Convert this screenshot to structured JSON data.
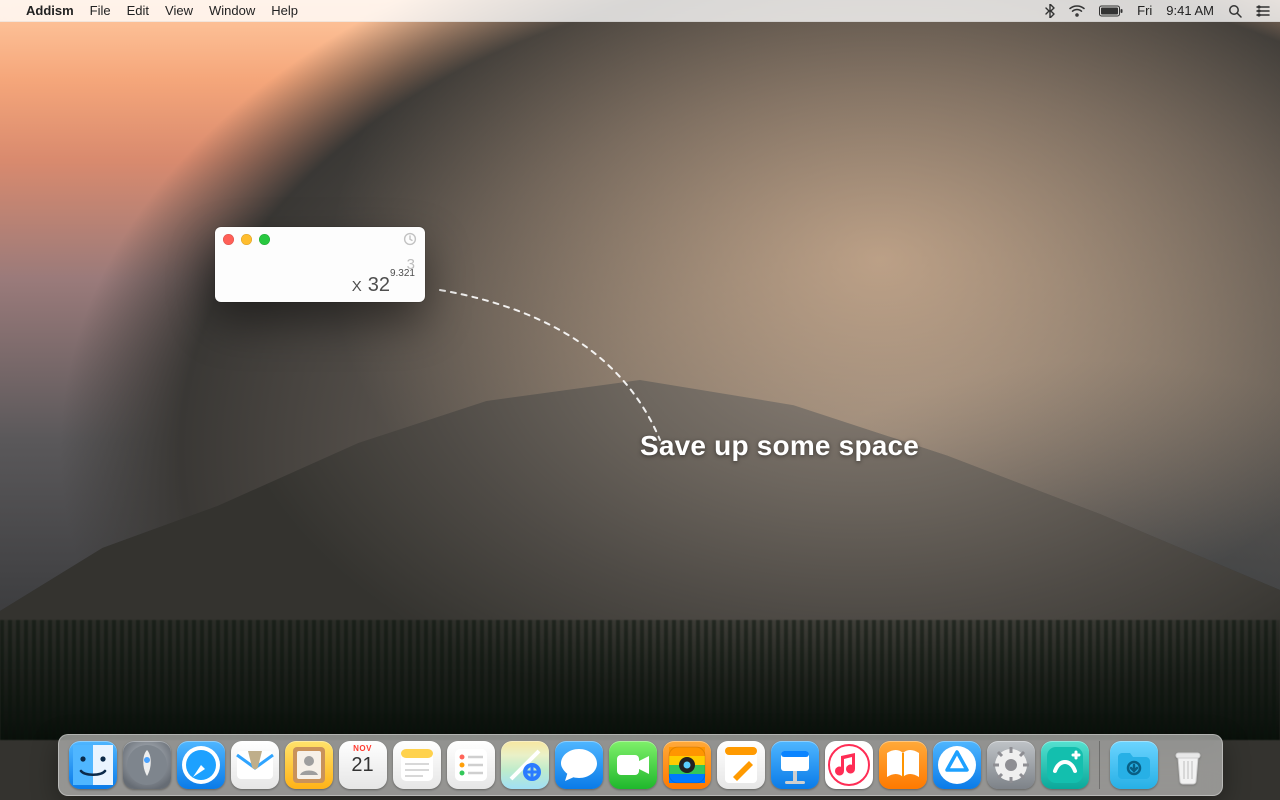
{
  "menubar": {
    "app_name": "Addism",
    "items": [
      "File",
      "Edit",
      "View",
      "Window",
      "Help"
    ],
    "status": {
      "day": "Fri",
      "time": "9:41 AM"
    }
  },
  "promo": {
    "caption": "Save up some space"
  },
  "mini_window": {
    "prev_value": "3",
    "operator": "X",
    "base": "32",
    "exponent": "9.321"
  },
  "dock": {
    "calendar": {
      "month": "NOV",
      "day": "21"
    },
    "items": [
      {
        "name": "finder",
        "label": "Finder",
        "class": "grad-blue",
        "glyph_svg": "finder"
      },
      {
        "name": "launchpad",
        "label": "Launchpad",
        "class": "grad-launch",
        "glyph_svg": "rocket"
      },
      {
        "name": "safari",
        "label": "Safari",
        "class": "grad-blue",
        "glyph_svg": "compass"
      },
      {
        "name": "mail",
        "label": "Mail",
        "class": "grad-white",
        "glyph_svg": "mail"
      },
      {
        "name": "contacts",
        "label": "Contacts",
        "class": "grad-yellow",
        "glyph_svg": "contacts"
      },
      {
        "name": "calendar",
        "label": "Calendar",
        "class": "grad-white",
        "glyph_svg": "calendar"
      },
      {
        "name": "notes",
        "label": "Notes",
        "class": "grad-white",
        "glyph_svg": "notes"
      },
      {
        "name": "reminders",
        "label": "Reminders",
        "class": "grad-white",
        "glyph_svg": "reminders"
      },
      {
        "name": "maps",
        "label": "Maps",
        "class": "grad-maps",
        "glyph_svg": "maps"
      },
      {
        "name": "messages",
        "label": "Messages",
        "class": "grad-blue",
        "glyph_svg": "bubble"
      },
      {
        "name": "facetime",
        "label": "FaceTime",
        "class": "grad-green",
        "glyph_svg": "video"
      },
      {
        "name": "photobooth",
        "label": "Photo Booth",
        "class": "grad-orange",
        "glyph_svg": "stripes"
      },
      {
        "name": "pages",
        "label": "Pages",
        "class": "grad-white",
        "glyph_svg": "pen"
      },
      {
        "name": "keynote",
        "label": "Keynote",
        "class": "grad-blue",
        "glyph_svg": "podium"
      },
      {
        "name": "itunes",
        "label": "iTunes",
        "class": "grad-music",
        "glyph_svg": "music"
      },
      {
        "name": "ibooks",
        "label": "iBooks",
        "class": "grad-orange",
        "glyph_svg": "book"
      },
      {
        "name": "appstore",
        "label": "App Store",
        "class": "grad-blue",
        "glyph_svg": "appstore"
      },
      {
        "name": "sysprefs",
        "label": "System Preferences",
        "class": "grad-dgrey",
        "glyph_svg": "gear"
      },
      {
        "name": "addism-dock",
        "label": "Addism",
        "class": "grad-teal",
        "glyph_svg": "addism"
      }
    ]
  }
}
